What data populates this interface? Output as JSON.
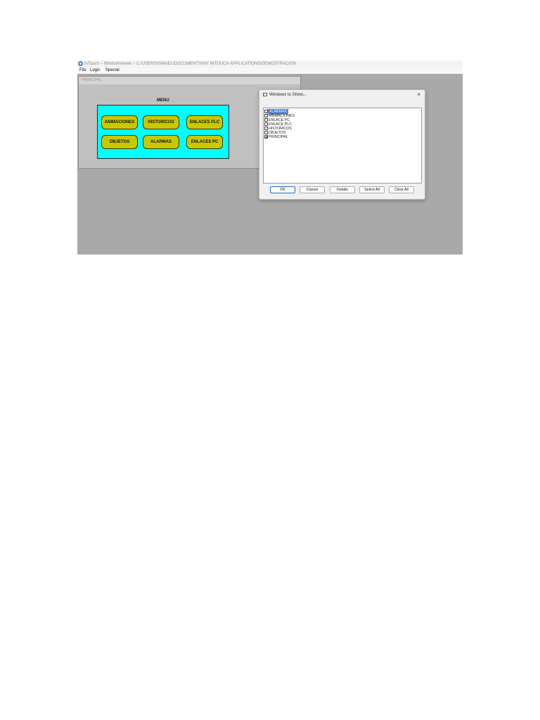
{
  "titlebar": {
    "title": "InTouch – WindowViewer – C:\\USERS\\ISMAEL\\DOCUMENTS\\MY INTOUCH APPLICATIONS\\DEMOSTRACION"
  },
  "menubar": {
    "items": [
      "File",
      "Logic",
      "Special"
    ]
  },
  "principal_window": {
    "title": "PRINCIPAL",
    "menu_label": "MENU",
    "buttons": [
      "ANIMACIONES",
      "HISTORICOS",
      "ENLACES PLC",
      "OBJETOS",
      "ALARMAS",
      "ENLACES PC"
    ],
    "panel_color": "#00ffff",
    "button_color": "#c8c800"
  },
  "dialog": {
    "title": "Windows to Show...",
    "close_glyph": "×",
    "items": [
      {
        "label": "ALARMAS",
        "checked": false,
        "selected": true
      },
      {
        "label": "ANIMACIONES",
        "checked": false,
        "selected": false
      },
      {
        "label": "ENLACE PC",
        "checked": false,
        "selected": false
      },
      {
        "label": "ENLACE PLC",
        "checked": false,
        "selected": false
      },
      {
        "label": "HISTORICOS",
        "checked": false,
        "selected": false
      },
      {
        "label": "OBJETOS",
        "checked": false,
        "selected": false
      },
      {
        "label": "PRINCIPAL",
        "checked": true,
        "selected": false
      }
    ],
    "buttons": {
      "ok": "OK",
      "cancel": "Cancel",
      "details": "Details",
      "select_all": "Select All",
      "clear_all": "Clear All"
    }
  }
}
